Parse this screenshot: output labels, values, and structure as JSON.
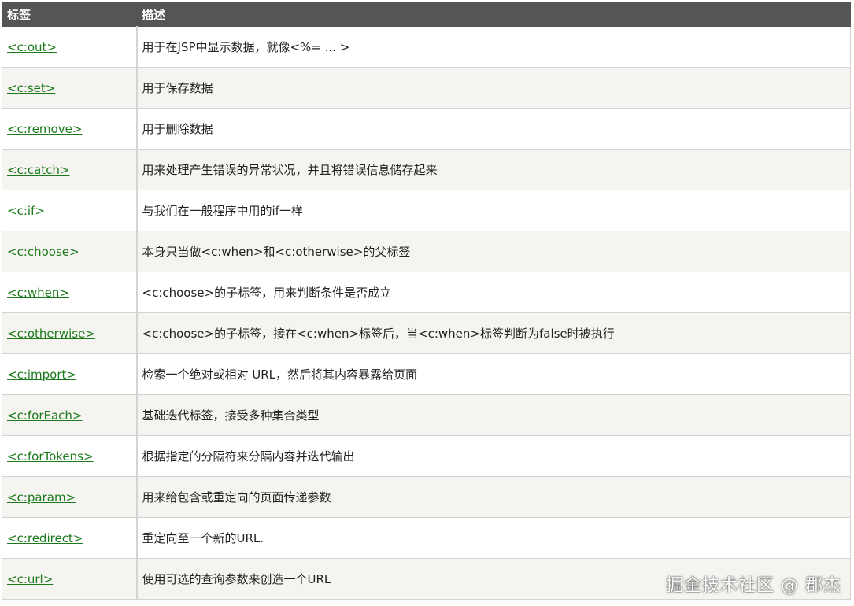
{
  "table": {
    "headers": [
      "标签",
      "描述"
    ],
    "rows": [
      {
        "tag": "<c:out>",
        "desc": "用于在JSP中显示数据，就像<%= ... >"
      },
      {
        "tag": "<c:set>",
        "desc": "用于保存数据"
      },
      {
        "tag": "<c:remove>",
        "desc": "用于删除数据"
      },
      {
        "tag": "<c:catch>",
        "desc": "用来处理产生错误的异常状况，并且将错误信息储存起来"
      },
      {
        "tag": "<c:if>",
        "desc": "与我们在一般程序中用的if一样"
      },
      {
        "tag": "<c:choose>",
        "desc": "本身只当做<c:when>和<c:otherwise>的父标签"
      },
      {
        "tag": "<c:when>",
        "desc": "<c:choose>的子标签，用来判断条件是否成立"
      },
      {
        "tag": "<c:otherwise>",
        "desc": "<c:choose>的子标签，接在<c:when>标签后，当<c:when>标签判断为false时被执行"
      },
      {
        "tag": "<c:import>",
        "desc": "检索一个绝对或相对 URL，然后将其内容暴露给页面"
      },
      {
        "tag": "<c:forEach>",
        "desc": "基础迭代标签，接受多种集合类型"
      },
      {
        "tag": "<c:forTokens>",
        "desc": "根据指定的分隔符来分隔内容并迭代输出"
      },
      {
        "tag": "<c:param>",
        "desc": "用来给包含或重定向的页面传递参数"
      },
      {
        "tag": "<c:redirect>",
        "desc": "重定向至一个新的URL."
      },
      {
        "tag": "<c:url>",
        "desc": "使用可选的查询参数来创造一个URL"
      }
    ]
  },
  "watermark": "掘金技术社区 @ 郡杰",
  "colors": {
    "header_bg": "#555555",
    "header_text": "#ffffff",
    "link": "#1c7a1c",
    "row_alt_bg": "#f6f4f0",
    "border": "#d4d4d4"
  }
}
